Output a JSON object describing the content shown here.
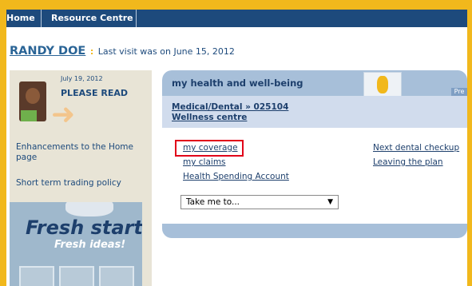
{
  "nav": {
    "items": [
      {
        "label": "Home"
      },
      {
        "label": "Resource Centre"
      }
    ]
  },
  "greeting": {
    "name": "RANDY DOE",
    "separator": ":",
    "last_visit": "Last visit was on June 15, 2012"
  },
  "sidebar": {
    "notice_date": "July 19, 2012",
    "notice_title": "PLEASE READ",
    "links": [
      {
        "label": "Enhancements to the Home page"
      },
      {
        "label": "Short term trading policy"
      }
    ],
    "promo": {
      "title": "Fresh start?",
      "subtitle": "Fresh ideas!"
    }
  },
  "panel": {
    "title": "my health and well-being",
    "prev_label": "Pre",
    "plan_links": [
      {
        "label": "Medical/Dental » 025104"
      },
      {
        "label": "Wellness centre"
      }
    ],
    "left_links": [
      {
        "label": "my coverage"
      },
      {
        "label": "my claims"
      },
      {
        "label": "Health Spending Account"
      }
    ],
    "right_links": [
      {
        "label": "Next dental checkup"
      },
      {
        "label": "Leaving the plan"
      }
    ],
    "dropdown": {
      "selected": "Take me to..."
    }
  },
  "colors": {
    "frame": "#f1b81c",
    "nav": "#1d4a7c",
    "highlight": "#e10019",
    "panel_header": "#a7bfd9"
  }
}
